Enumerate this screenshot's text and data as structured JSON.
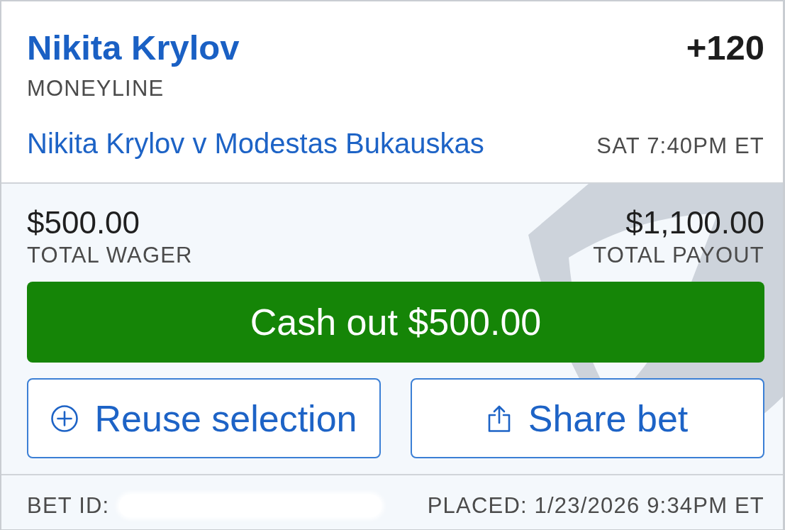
{
  "bet": {
    "selection": "Nikita Krylov",
    "odds": "+120",
    "market": "MONEYLINE",
    "event": "Nikita Krylov v Modestas Bukauskas",
    "start_time": "SAT 7:40PM ET"
  },
  "totals": [
    {
      "amount": "$500.00",
      "label": "TOTAL WAGER"
    },
    {
      "amount": "$1,100.00",
      "label": "TOTAL PAYOUT"
    }
  ],
  "cash_out": {
    "label": "Cash out $500.00"
  },
  "actions": [
    {
      "kind": "reuse",
      "label": "Reuse selection"
    },
    {
      "kind": "share",
      "label": "Share bet"
    }
  ],
  "footer": {
    "bet_id_label": "BET ID:",
    "bet_id_redacted": true,
    "placed": "PLACED: 1/23/2026 9:34PM ET"
  }
}
